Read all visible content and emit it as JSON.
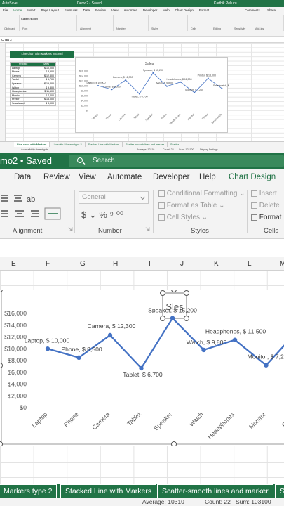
{
  "app": {
    "mini_title": "Demo2 • Saved",
    "mini_user": "Karthik Pelluru",
    "zoom_title": "mo2 • Saved",
    "search_placeholder": "Search",
    "autosave": "AutoSave"
  },
  "mini_menu": [
    "File",
    "Home",
    "Insert",
    "Page Layout",
    "Formulas",
    "Data",
    "Review",
    "View",
    "Automate",
    "Developer",
    "Help",
    "Chart Design",
    "Format"
  ],
  "mini_menu_right": [
    "Comments",
    "Share"
  ],
  "mini_ribbon_groups": [
    "Clipboard",
    "Font",
    "Alignment",
    "Number",
    "Styles",
    "Cells",
    "Editing",
    "Sensitivity",
    "Add-ins"
  ],
  "mini_font": "Calibri (Body)",
  "name_box": "Chart 2",
  "zoom_menu": {
    "items": [
      "Data",
      "Review",
      "View",
      "Automate",
      "Developer",
      "Help",
      "Chart Design"
    ],
    "active": "Chart Design"
  },
  "zoom_ribbon": {
    "number_format": "General",
    "conditional": "Conditional Formatting",
    "format_table": "Format as Table",
    "cell_styles": "Cell Styles",
    "insert": "Insert",
    "delete": "Delete",
    "format": "Format",
    "groups": {
      "alignment": "Alignment",
      "number": "Number",
      "styles": "Styles",
      "cells": "Cells"
    }
  },
  "columns": [
    "E",
    "F",
    "G",
    "H",
    "I",
    "J",
    "K",
    "L",
    "M"
  ],
  "table": {
    "title": "Line chart with Markers in Excel",
    "headers": [
      "Product",
      "Sales"
    ],
    "rows": [
      [
        "Laptop",
        "$ 10,000"
      ],
      [
        "Phone",
        "$ 8,500"
      ],
      [
        "Camera",
        "$ 12,300"
      ],
      [
        "Tablet",
        "$ 6,700"
      ],
      [
        "Speaker",
        "$ 15,200"
      ],
      [
        "Watch",
        "$ 9,800"
      ],
      [
        "Headphones",
        "$ 11,500"
      ],
      [
        "Monitor",
        "$ 7,200"
      ],
      [
        "Printer",
        "$ 13,000"
      ],
      [
        "Smartwatch",
        "$ 8,900"
      ]
    ]
  },
  "chart_data": {
    "type": "line",
    "title": "Sales",
    "categories": [
      "Laptop",
      "Phone",
      "Camera",
      "Tablet",
      "Speaker",
      "Watch",
      "Headphones",
      "Monitor",
      "Printer",
      "Smartwatch"
    ],
    "values": [
      10000,
      8500,
      12300,
      6700,
      15200,
      9800,
      11500,
      7200,
      13000,
      8900
    ],
    "data_labels": [
      "Laptop, $ 10,000",
      "Phone, $ 8,500",
      "Camera, $ 12,300",
      "Tablet, $ 6,700",
      "Speaker, $ 15,200",
      "Watch, $ 9,800",
      "Headphones, $ 11,500",
      "Monitor, $ 7,200",
      "Printer, $ 13,000",
      "Smartwatch, $ 8,900"
    ],
    "zoom_title_text": "Sles",
    "y_ticks": [
      "$0",
      "$2,000",
      "$4,000",
      "$6,000",
      "$8,000",
      "$10,000",
      "$12,000",
      "$14,000",
      "$16,000"
    ],
    "ylim": [
      0,
      16000
    ],
    "series_color": "#4472c4",
    "grid": false
  },
  "sheet_tabs": [
    "Line chart with Markers",
    "Line with Markers type 2",
    "Stacked Line with Markers",
    "Scatter-smooth lines and marker",
    "Scatter"
  ],
  "zoom_tabs": [
    "Markers type 2",
    "Stacked Line with Markers",
    "Scatter-smooth lines and marker",
    "S"
  ],
  "status": {
    "average": "Average: 10310",
    "count": "Count: 22",
    "sum": "Sum: 103100",
    "accessibility": "Accessibility: Investigate",
    "display": "Display Settings"
  },
  "colors": {
    "brand": "#217346",
    "table_header": "#1e7145",
    "line": "#4472c4"
  }
}
